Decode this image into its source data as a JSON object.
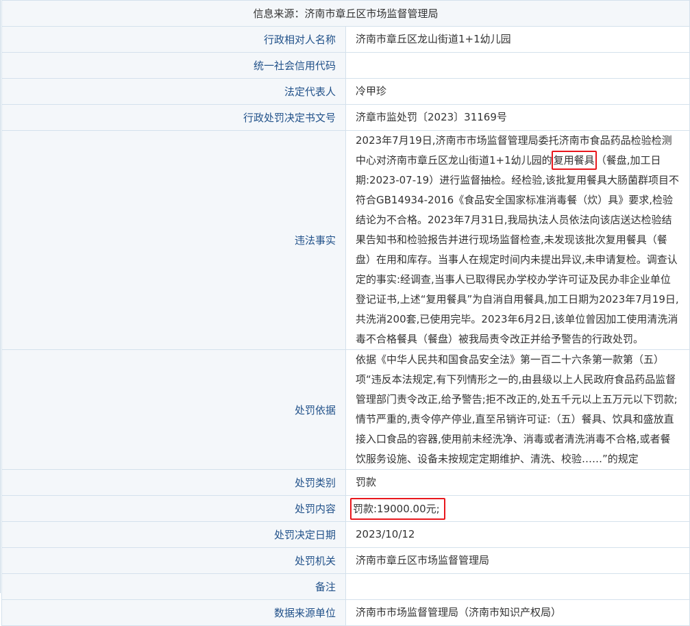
{
  "source": "信息来源：济南市章丘区市场监督管理局",
  "rows": [
    {
      "label": "行政相对人名称",
      "value": "济南市章丘区龙山街道1+1幼儿园"
    },
    {
      "label": "统一社会信用代码",
      "value": ""
    },
    {
      "label": "法定代表人",
      "value": "冷甲珍"
    },
    {
      "label": "行政处罚决定书文号",
      "value": "济章市监处罚〔2023〕31169号"
    },
    {
      "label": "违法事实",
      "value_pre": "2023年7月19日,济南市市场监督管理局委托济南市食品药品检验检测中心对济南市章丘区龙山街道1+1幼儿园的",
      "value_highlight": "复用餐具",
      "value_post": "（餐盘,加工日期:2023-07-19）进行监督抽检。经检验,该批复用餐具大肠菌群项目不符合GB14934-2016《食品安全国家标准消毒餐（炊）具》要求,检验结论为不合格。2023年7月31日,我局执法人员依法向该店送达检验结果告知书和检验报告并进行现场监督检查,未发现该批次复用餐具（餐盘）在用和库存。当事人在规定时间内未提出异议,未申请复检。调查认定的事实:经调查,当事人已取得民办学校办学许可证及民办非企业单位登记证书,上述“复用餐具”为自消自用餐具,加工日期为2023年7月19日,共洗消200套,已使用完毕。2023年6月2日,该单位曾因加工使用清洗消毒不合格餐具（餐盘）被我局责令改正并给予警告的行政处罚。"
    },
    {
      "label": "处罚依据",
      "value": "依据《中华人民共和国食品安全法》第一百二十六条第一款第（五）项“违反本法规定,有下列情形之一的,由县级以上人民政府食品药品监督管理部门责令改正,给予警告;拒不改正的,处五千元以上五万元以下罚款;情节严重的,责令停产停业,直至吊销许可证:（五）餐具、饮具和盛放直接入口食品的容器,使用前未经洗净、消毒或者清洗消毒不合格,或者餐饮服务设施、设备未按规定定期维护、清洗、校验……”的规定"
    },
    {
      "label": "处罚类别",
      "value": "罚款"
    },
    {
      "label": "处罚内容",
      "value": "罚款:19000.00元;"
    },
    {
      "label": "处罚决定日期",
      "value": "2023/10/12"
    },
    {
      "label": "处罚机关",
      "value": "济南市章丘区市场监督管理局"
    },
    {
      "label": "备注",
      "value": ""
    },
    {
      "label": "数据来源单位",
      "value": "济南市市场监督管理局（济南市知识产权局）"
    }
  ]
}
